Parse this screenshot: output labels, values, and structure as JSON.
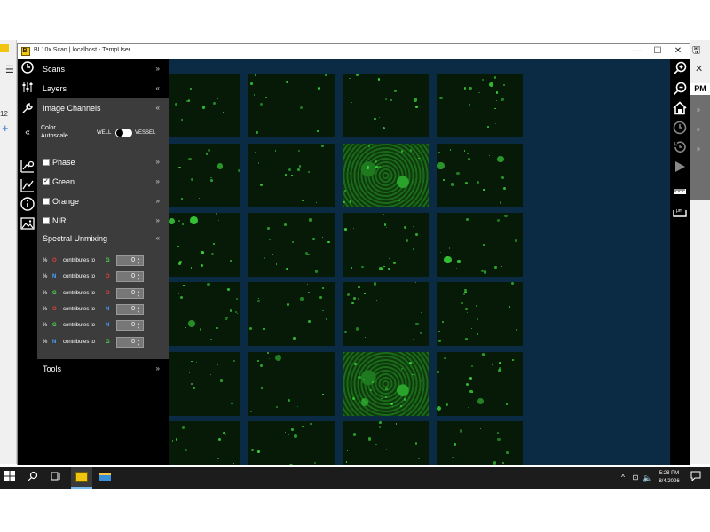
{
  "window": {
    "title": "BI 10x Scan | localhost - TempUser",
    "app_badge": "BI",
    "controls": {
      "minimize": "—",
      "maximize": "☐",
      "close": "✕"
    }
  },
  "background_app": {
    "left_tab_text": "12",
    "left_plus": "+",
    "right_label": "PM"
  },
  "panel": {
    "scans_label": "Scans",
    "layers_label": "Layers",
    "image_channels_label": "Image Channels",
    "collapse_symbol": "«",
    "chev_down": "»",
    "chev_up": "«",
    "color_autoscale_label": "Color Autoscale",
    "autoscale_toggle": {
      "left_label": "WELL",
      "right_label": "VESSEL",
      "state": "WELL"
    },
    "channels": [
      {
        "label": "Phase",
        "checked": false,
        "check": ""
      },
      {
        "label": "Green",
        "checked": true,
        "check": "✓"
      },
      {
        "label": "Orange",
        "checked": false,
        "check": ""
      },
      {
        "label": "NIR",
        "checked": false,
        "check": ""
      }
    ],
    "spectral_unmixing_label": "Spectral Unmixing",
    "unmixing": {
      "contributes_text": "contributes to",
      "pct": "%",
      "rows": [
        {
          "from": "O",
          "to": "G",
          "value": "0"
        },
        {
          "from": "N",
          "to": "O",
          "value": "0"
        },
        {
          "from": "G",
          "to": "O",
          "value": "0"
        },
        {
          "from": "O",
          "to": "N",
          "value": "0"
        },
        {
          "from": "G",
          "to": "N",
          "value": "0"
        },
        {
          "from": "N",
          "to": "G",
          "value": "0"
        }
      ]
    },
    "tools_label": "Tools"
  },
  "taskbar": {
    "time": "5:28 PM",
    "date": "8/4/2026"
  },
  "colors": {
    "viewer_bg": "#0b2a44",
    "fluorescence_green": "#3bd43b",
    "panel_gray": "#3c3c3c"
  }
}
